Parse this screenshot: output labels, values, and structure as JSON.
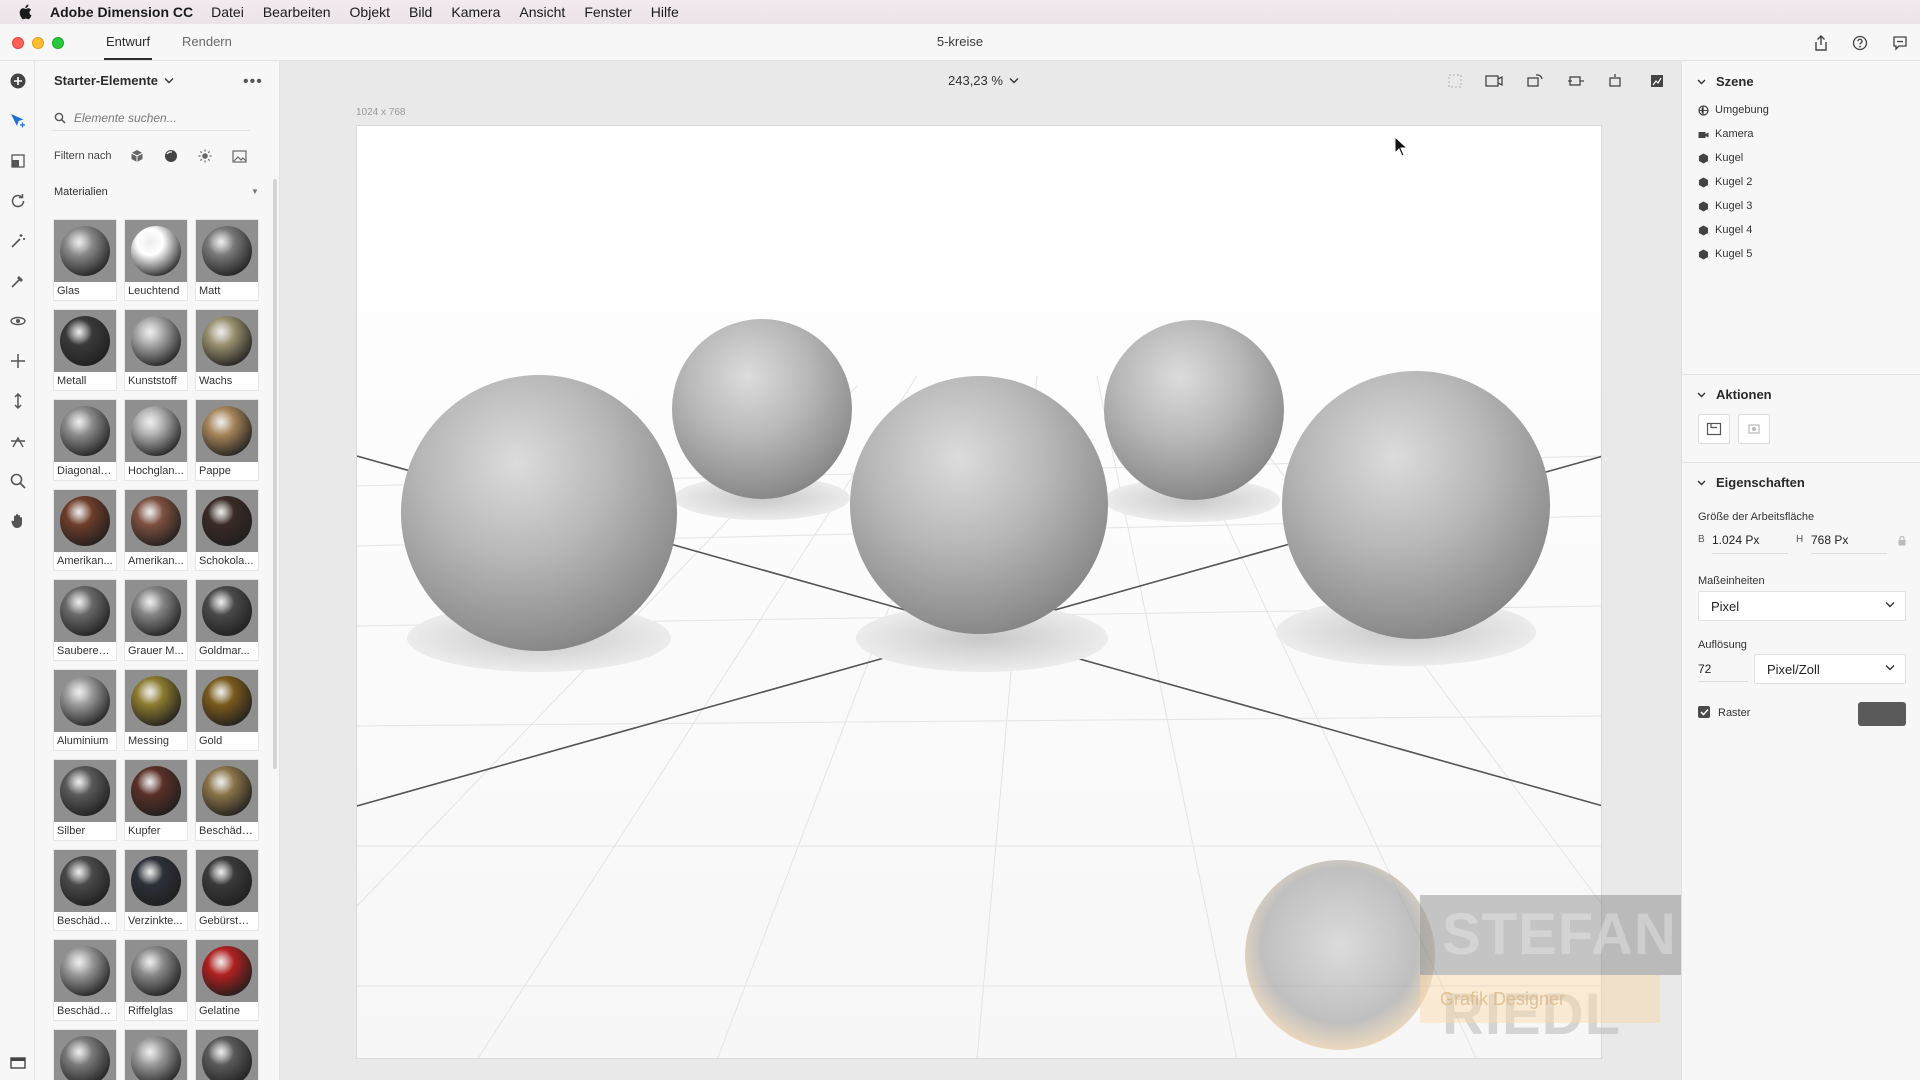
{
  "menubar": {
    "app_name": "Adobe Dimension CC",
    "items": [
      "Datei",
      "Bearbeiten",
      "Objekt",
      "Bild",
      "Kamera",
      "Ansicht",
      "Fenster",
      "Hilfe"
    ]
  },
  "titlebar": {
    "tabs": [
      "Entwurf",
      "Rendern"
    ],
    "active_tab": "Entwurf",
    "document_title": "5-kreise"
  },
  "assets": {
    "header": "Starter-Elemente",
    "search_placeholder": "Elemente suchen...",
    "filter_label": "Filtern nach",
    "section": "Materialien",
    "materials": [
      {
        "label": "Glas",
        "color": "#8a8a8a"
      },
      {
        "label": "Leuchtend",
        "color": "#ffffff"
      },
      {
        "label": "Matt",
        "color": "#7a7a7a"
      },
      {
        "label": "Metall",
        "color": "#3a3a3a"
      },
      {
        "label": "Kunststoff",
        "color": "#a8a8a8"
      },
      {
        "label": "Wachs",
        "color": "#9a9170"
      },
      {
        "label": "Diagonalp...",
        "color": "#8c8c8c"
      },
      {
        "label": "Hochglan...",
        "color": "#b0b0b0"
      },
      {
        "label": "Pappe",
        "color": "#a6855a"
      },
      {
        "label": "Amerikan...",
        "color": "#6e3d2a"
      },
      {
        "label": "Amerikan...",
        "color": "#7d5040"
      },
      {
        "label": "Schokola...",
        "color": "#3a2a26"
      },
      {
        "label": "Sauberer ...",
        "color": "#6a6a6a"
      },
      {
        "label": "Grauer M...",
        "color": "#858585"
      },
      {
        "label": "Goldmar...",
        "color": "#4a4a4a"
      },
      {
        "label": "Aluminium",
        "color": "#9a9a9a"
      },
      {
        "label": "Messing",
        "color": "#8c7b2e"
      },
      {
        "label": "Gold",
        "color": "#7a5a1c"
      },
      {
        "label": "Silber",
        "color": "#5a5a5a"
      },
      {
        "label": "Kupfer",
        "color": "#5a3028"
      },
      {
        "label": "Beschädig...",
        "color": "#8a7448"
      },
      {
        "label": "Beschädig...",
        "color": "#4a4a4a"
      },
      {
        "label": "Verzinkte...",
        "color": "#2c3038"
      },
      {
        "label": "Gebürstet...",
        "color": "#3a3a3a"
      },
      {
        "label": "Beschädig...",
        "color": "#9a9a9a"
      },
      {
        "label": "Riffelglas",
        "color": "#8a8a8a"
      },
      {
        "label": "Gelatine",
        "color": "#b02020"
      },
      {
        "label": "",
        "color": "#7a7a7a"
      },
      {
        "label": "",
        "color": "#9a9a9a"
      },
      {
        "label": "",
        "color": "#5a5a5a"
      }
    ]
  },
  "canvas": {
    "zoom": "243,23 %",
    "size_label": "1024 x 768"
  },
  "scene": {
    "title": "Szene",
    "items": [
      {
        "label": "Umgebung",
        "icon": "environment-icon"
      },
      {
        "label": "Kamera",
        "icon": "camera-icon"
      },
      {
        "label": "Kugel",
        "icon": "sphere-icon"
      },
      {
        "label": "Kugel 2",
        "icon": "sphere-icon"
      },
      {
        "label": "Kugel 3",
        "icon": "sphere-icon"
      },
      {
        "label": "Kugel 4",
        "icon": "sphere-icon"
      },
      {
        "label": "Kugel 5",
        "icon": "sphere-icon"
      }
    ]
  },
  "actions": {
    "title": "Aktionen"
  },
  "properties": {
    "title": "Eigenschaften",
    "canvas_size_label": "Größe der Arbeitsfläche",
    "width_prefix": "B",
    "width_value": "1.024 Px",
    "height_prefix": "H",
    "height_value": "768 Px",
    "units_label": "Maßeinheiten",
    "units_value": "Pixel",
    "resolution_label": "Auflösung",
    "resolution_value": "72",
    "resolution_unit": "Pixel/Zoll",
    "grid_label": "Raster",
    "grid_checked": true
  },
  "watermark": {
    "name": "STEFAN RIEDL",
    "subtitle": "Grafik Designer"
  }
}
